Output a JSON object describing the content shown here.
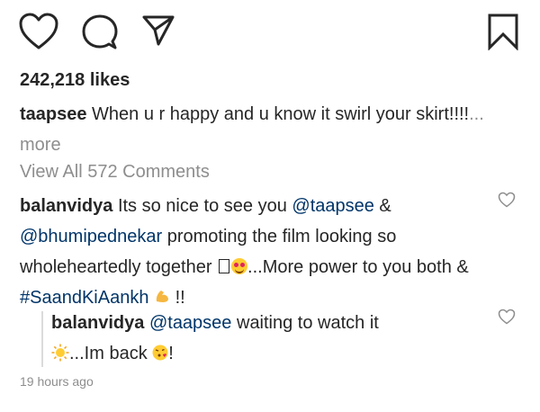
{
  "actions": {
    "like_icon": "heart-icon",
    "comment_icon": "comment-icon",
    "share_icon": "share-icon",
    "save_icon": "bookmark-icon"
  },
  "post": {
    "likes": "242,218 likes",
    "caption_user": "taapsee",
    "caption_text": " When u r happy and u know it swirl your skirt!!!!",
    "more": "... more",
    "view_all_comments": "View All 572 Comments"
  },
  "comment": {
    "user": "balanvidya",
    "text_1": " Its so nice to see you ",
    "mention_1": "@taapsee",
    "text_2": " & ",
    "mention_2": "@bhumipednekar",
    "text_3": " promoting the film looking so wholeheartedly together ",
    "text_4": "...More power to you both & ",
    "hashtag": "#SaandKiAankh",
    "text_5": " !!"
  },
  "reply": {
    "user": "balanvidya",
    "mention": "@taapsee",
    "text_1": " waiting to watch it ",
    "text_2": "...Im back ",
    "text_3": "!"
  },
  "timestamp": "19 hours ago",
  "colors": {
    "text": "#262626",
    "muted": "#8e8e8e",
    "link": "#003569"
  }
}
